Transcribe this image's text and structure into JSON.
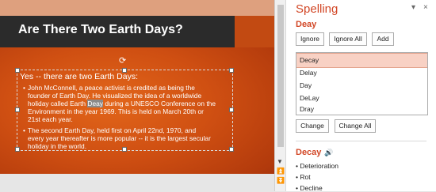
{
  "slide": {
    "title": "Are There Two Earth Days?",
    "bullet1": "Yes -- there are two Earth Days:",
    "sub1_lines": [
      "John McConnell, a peace activist is credited as being the",
      "founder of Earth Day. He visualized the idea of a worldwide",
      "holiday called Earth",
      "during a UNESCO Conference on the",
      "Environment in the year 1969. This is held on March 20th or",
      "21st each year."
    ],
    "highlighted_word": "Deay",
    "sub2_lines": [
      "The second Earth Day, held first on April 22nd, 1970, and",
      "every year thereafter is more popular -- it is the largest secular",
      "holiday in the world."
    ]
  },
  "pane": {
    "title": "Spelling",
    "close_glyph": "×",
    "options_glyph": "▾",
    "misspelled_word": "Deay",
    "buttons": {
      "ignore": "Ignore",
      "ignore_all": "Ignore All",
      "add": "Add",
      "change": "Change",
      "change_all": "Change All"
    },
    "suggestions": [
      "Decay",
      "Delay",
      "Day",
      "DeLay",
      "Dray"
    ],
    "selected_suggestion": "Decay",
    "definition_word": "Decay",
    "synonyms": [
      "Deterioration",
      "Rot",
      "Decline"
    ]
  },
  "colors": {
    "accent": "#d24726",
    "slide_orange": "#d55a16",
    "title_bar": "#2b2b2b"
  }
}
